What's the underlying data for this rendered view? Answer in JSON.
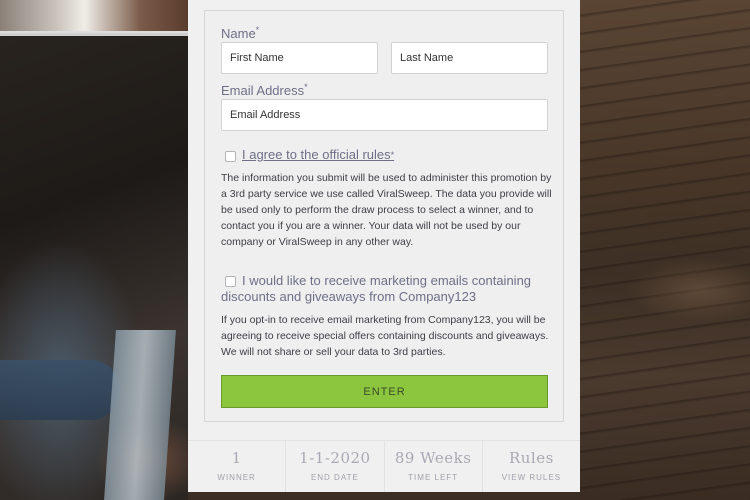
{
  "form": {
    "name_label": "Name",
    "required_mark": "*",
    "first_name_placeholder": "First Name",
    "last_name_placeholder": "Last Name",
    "email_label": "Email Address",
    "email_placeholder": "Email Address",
    "rules_checkbox_label": "I agree to the official rules",
    "rules_required_mark": "*",
    "rules_disclaimer": "The information you submit will be used to administer this promotion by a 3rd party service we use called ViralSweep. The data you provide will be used only to perform the draw process to select a winner, and to contact you if you are a winner. Your data will not be used by our company or ViralSweep in any other way.",
    "marketing_checkbox_label": "I would like to receive marketing emails containing discounts and giveaways from Company123",
    "marketing_disclaimer": "If you opt-in to receive email marketing from Company123, you will be agreeing to receive special offers containing discounts and giveaways. We will not share or sell your data to 3rd parties.",
    "enter_label": "ENTER"
  },
  "stats": [
    {
      "value": "1",
      "label": "WINNER"
    },
    {
      "value": "1-1-2020",
      "label": "END DATE"
    },
    {
      "value": "89 Weeks",
      "label": "TIME LEFT"
    },
    {
      "value": "Rules",
      "label": "VIEW RULES"
    }
  ],
  "colors": {
    "accent_green": "#8cc63f",
    "label_purple": "#6e6f87"
  }
}
